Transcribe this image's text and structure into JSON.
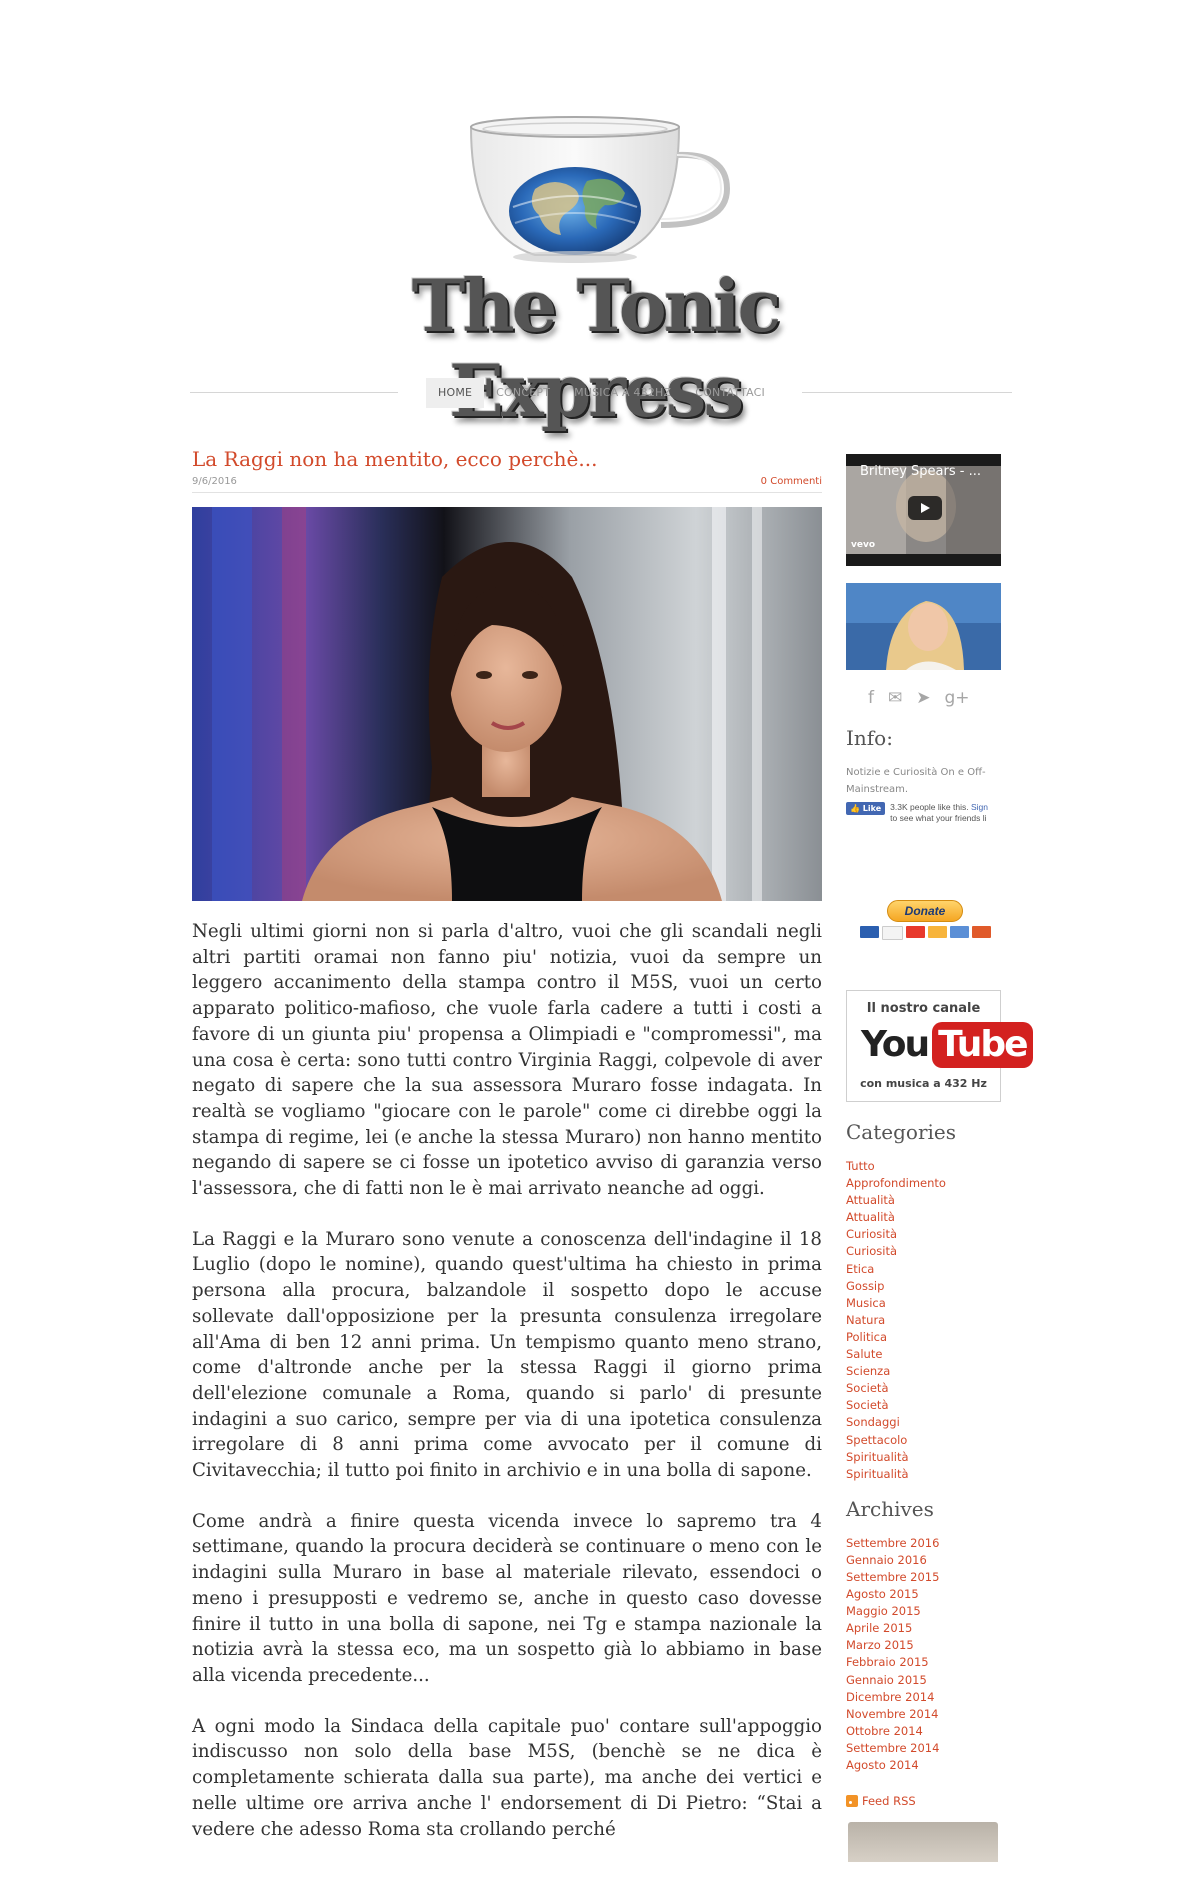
{
  "site": {
    "title": "The Tonic Express"
  },
  "nav": {
    "items": [
      {
        "label": "HOME"
      },
      {
        "label": "CONCEPT"
      },
      {
        "label": "MUSICA A 432HZ"
      },
      {
        "label": "CONTATTACI"
      }
    ]
  },
  "post": {
    "title": "La Raggi non ha mentito, ecco perchè...",
    "date": "9/6/2016",
    "comments": "0 Commenti",
    "paragraphs": [
      "Negli ultimi giorni non si parla d'altro, vuoi che gli scandali negli altri partiti oramai non fanno piu' notizia, vuoi da sempre un leggero accanimento della stampa contro il M5S, vuoi un certo apparato politico-mafioso, che vuole farla cadere a tutti i costi a favore di un giunta piu' propensa a Olimpiadi e \"compromessi\",  ma una cosa è certa: sono tutti contro Virginia Raggi, colpevole di aver negato di sapere che la sua assessora Muraro fosse indagata. In realtà se vogliamo \"giocare con le parole\" come ci direbbe oggi la stampa di regime, lei (e anche la stessa Muraro) non hanno mentito negando di sapere se ci fosse un ipotetico avviso di garanzia verso l'assessora, che di fatti non le è mai arrivato neanche ad oggi.",
      "La Raggi e la Muraro sono venute a conoscenza dell'indagine il 18 Luglio (dopo le nomine), quando quest'ultima ha chiesto in prima persona alla procura, balzandole il sospetto dopo le accuse sollevate dall'opposizione per la presunta consulenza irregolare all'Ama di ben 12 anni prima. Un tempismo quanto meno strano, come d'altronde anche per la stessa Raggi il giorno prima dell'elezione comunale a Roma, quando si parlo' di presunte indagini a suo carico, sempre per via di una ipotetica consulenza irregolare di 8 anni prima come avvocato per il comune di Civitavecchia; il tutto poi finito in archivio e in una bolla di sapone.",
      "Come andrà a finire questa vicenda invece lo sapremo tra 4 settimane, quando la procura deciderà se continuare o meno con le indagini sulla Muraro in base al materiale rilevato, essendoci o meno i presupposti e vedremo se, anche in questo caso dovesse finire il tutto in una bolla di sapone, nei Tg e stampa nazionale la notizia avrà la stessa eco, ma un sospetto già lo abbiamo in base alla vicenda precedente...",
      "A ogni modo la Sindaca della capitale puo' contare sull'appoggio indiscusso non solo della base M5S, (benchè se ne dica è completamente schierata dalla sua parte), ma anche dei vertici e nelle ultime ore arriva anche l' endorsement di Di Pietro: “Stai a vedere che adesso Roma sta crollando perché"
    ]
  },
  "sidebar": {
    "video_title": "Britney Spears - ...",
    "video_logo": "vevo",
    "social_icons": [
      "facebook-icon",
      "mail-icon",
      "twitter-icon",
      "google-plus-icon"
    ],
    "social_glyphs": [
      "f",
      "✉",
      "➤",
      "g+"
    ],
    "info_heading": "Info:",
    "info_text": "Notizie e Curiosità On e Off-Mainstream.",
    "fb_like_label": "Like",
    "fb_count_text": "3.3K people like this.",
    "fb_sign": "Sign",
    "fb_line2": "to see what your friends li",
    "donate_label": "Donate",
    "yt_top": "Il nostro canale",
    "yt_you": "You",
    "yt_tube": "Tube",
    "yt_bottom": "con musica a 432 Hz",
    "categories_heading": "Categories",
    "categories": [
      "Tutto",
      "Approfondimento",
      "Attualità",
      "Attualità",
      "Curiosità",
      "Curiosità",
      "Etica",
      "Gossip",
      "Musica",
      "Natura",
      "Politica",
      "Salute",
      "Scienza",
      "Società",
      "Società",
      "Sondaggi",
      "Spettacolo",
      "Spiritualità",
      "Spiritualità"
    ],
    "archives_heading": "Archives",
    "archives": [
      "Settembre 2016",
      "Gennaio 2016",
      "Settembre 2015",
      "Agosto 2015",
      "Maggio 2015",
      "Aprile 2015",
      "Marzo 2015",
      "Febbraio 2015",
      "Gennaio 2015",
      "Dicembre 2014",
      "Novembre 2014",
      "Ottobre 2014",
      "Settembre 2014",
      "Agosto 2014"
    ],
    "rss_label": "Feed RSS"
  },
  "colors": {
    "accent": "#d24a2b",
    "nav_active_bg": "#eeeeee",
    "text": "#333333"
  }
}
